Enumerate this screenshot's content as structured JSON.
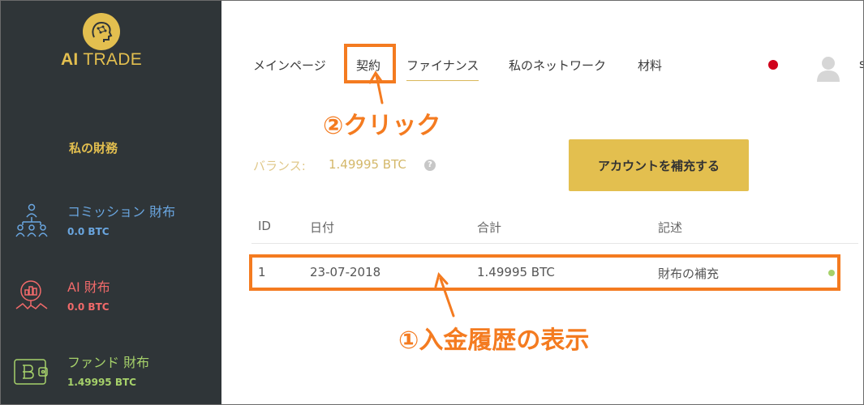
{
  "brand": {
    "name_bold": "AI",
    "name_rest": "TRADE",
    "logo_icon": "brain-circuit-icon"
  },
  "sidebar": {
    "section_title": "私の財務",
    "wallets": [
      {
        "name": "コミッション 財布",
        "balance": "0.0 BTC",
        "icon": "network-people-icon",
        "color": "#6aa6e0"
      },
      {
        "name": "AI 財布",
        "balance": "0.0 BTC",
        "icon": "ai-chart-icon",
        "color": "#f16a6a"
      },
      {
        "name": "ファンド 財布",
        "balance": "1.49995 BTC",
        "icon": "bitcoin-wallet-icon",
        "color": "#a6d16a"
      }
    ]
  },
  "nav": {
    "items": [
      "メインページ",
      "契約",
      "ファイナンス",
      "私のネットワーク",
      "材料"
    ],
    "active": "ファイナンス",
    "edge_text": "s"
  },
  "balance": {
    "label": "バランス:",
    "value": "1.49995 BTC",
    "help": "?"
  },
  "topup_button": "アカウントを補充する",
  "table": {
    "headers": [
      "ID",
      "日付",
      "合計",
      "記述"
    ],
    "rows": [
      {
        "id": "1",
        "date": "23-07-2018",
        "amount": "1.49995 BTC",
        "description": "財布の補充",
        "status_color": "#a6d16a"
      }
    ]
  },
  "annotations": {
    "step2": "②クリック",
    "step1": "①入金履歴の表示",
    "color": "#f47b20"
  }
}
